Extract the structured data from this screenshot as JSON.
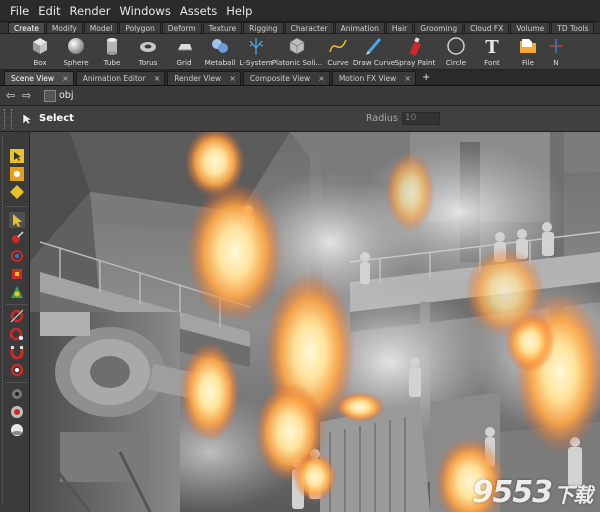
{
  "menubar": {
    "items": [
      {
        "label": "File"
      },
      {
        "label": "Edit"
      },
      {
        "label": "Render"
      },
      {
        "label": "Windows"
      },
      {
        "label": "Assets"
      },
      {
        "label": "Help"
      }
    ]
  },
  "shelf_tabs": {
    "items": [
      {
        "label": "Create",
        "active": true
      },
      {
        "label": "Modify"
      },
      {
        "label": "Model"
      },
      {
        "label": "Polygon"
      },
      {
        "label": "Deform"
      },
      {
        "label": "Texture"
      },
      {
        "label": "Rigging"
      },
      {
        "label": "Character"
      },
      {
        "label": "Animation"
      },
      {
        "label": "Hair"
      },
      {
        "label": "Grooming"
      },
      {
        "label": "Cloud FX"
      },
      {
        "label": "Volume"
      },
      {
        "label": "TD Tools"
      }
    ],
    "add_label": "+"
  },
  "shelf_tools": {
    "items": [
      {
        "label": "Box",
        "icon": "box-icon"
      },
      {
        "label": "Sphere",
        "icon": "sphere-icon"
      },
      {
        "label": "Tube",
        "icon": "tube-icon"
      },
      {
        "label": "Torus",
        "icon": "torus-icon"
      },
      {
        "label": "Grid",
        "icon": "grid-icon"
      },
      {
        "label": "Metaball",
        "icon": "metaball-icon"
      },
      {
        "label": "L-System",
        "icon": "lsystem-icon"
      },
      {
        "label": "Platonic Soli...",
        "icon": "platonic-icon"
      },
      {
        "label": "Curve",
        "icon": "curve-icon"
      },
      {
        "label": "Draw Curve",
        "icon": "draw-curve-icon"
      },
      {
        "label": "Spray Paint",
        "icon": "spray-paint-icon"
      },
      {
        "label": "Circle",
        "icon": "circle-icon"
      },
      {
        "label": "Font",
        "icon": "font-icon"
      },
      {
        "label": "File",
        "icon": "file-icon"
      },
      {
        "label": "N",
        "icon": "null-icon"
      }
    ],
    "font_glyph": "T"
  },
  "pane_tabs": {
    "items": [
      {
        "label": "Scene View",
        "active": true
      },
      {
        "label": "Animation Editor"
      },
      {
        "label": "Render View"
      },
      {
        "label": "Composite View"
      },
      {
        "label": "Motion FX View"
      }
    ],
    "close_glyph": "×",
    "add_label": "+"
  },
  "pathbar": {
    "back_glyph": "⇦",
    "forward_glyph": "⇨",
    "path": "obj"
  },
  "operation": {
    "mode": "Select",
    "radius_label": "Radius",
    "radius_value": "10"
  },
  "watermark": {
    "main": "9553",
    "sub": "下载"
  },
  "colors": {
    "menubar": "#2b2b2b",
    "accent_yellow": "#e8c22a",
    "accent_red": "#cc2a2a",
    "fire_core": "#fff4c8",
    "fire_mid": "#ffb347",
    "fire_edge": "#e0622a"
  }
}
